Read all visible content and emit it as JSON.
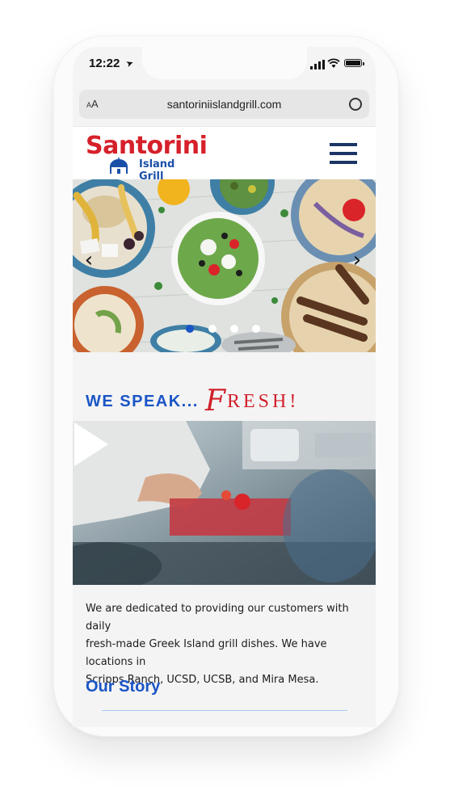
{
  "status_bar": {
    "time": "12:22"
  },
  "browser": {
    "url": "santoriniislandgrill.com",
    "text_size_label_small": "A",
    "text_size_label_large": "A"
  },
  "brand": {
    "name": "Santorini",
    "subtitle": "Island Grill",
    "red": "#d6202a",
    "blue": "#1a4fa8"
  },
  "nav": {
    "menu_icon": "hamburger-menu-icon"
  },
  "carousel": {
    "prev_icon": "chevron-left-icon",
    "next_icon": "chevron-right-icon",
    "slide_count": 4,
    "active_slide": 1
  },
  "headline": {
    "lead": "WE SPEAK...",
    "fresh_initial": "F",
    "fresh_rest": "RESH!"
  },
  "video": {
    "play_icon": "play-icon"
  },
  "intro": {
    "text_line_1": "We are dedicated to providing our customers with daily",
    "text_line_2": "fresh-made Greek Island grill dishes. We have locations in",
    "text_line_3": "Scripps Ranch, UCSD, UCSB, and Mira Mesa."
  },
  "story": {
    "title": "Our Story"
  },
  "colors": {
    "accent_blue": "#1a55c6",
    "accent_red": "#d0202a",
    "menu_navy": "#1d3565"
  }
}
